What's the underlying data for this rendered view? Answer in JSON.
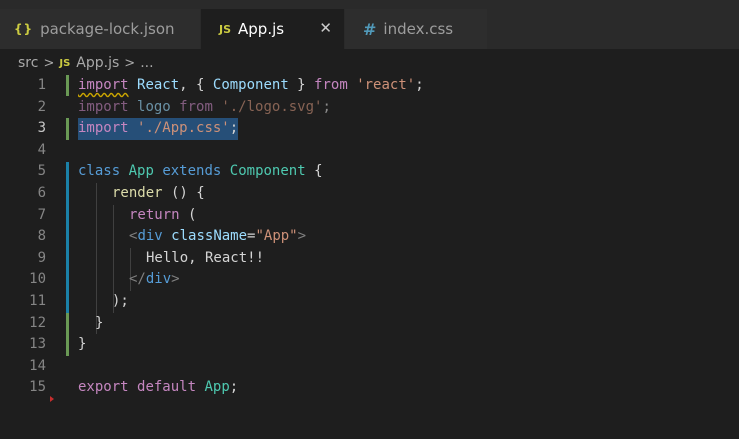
{
  "tabs": [
    {
      "icon": "{}",
      "icon_name": "json-file-icon",
      "label": "package-lock.json",
      "active": false
    },
    {
      "icon": "JS",
      "icon_name": "javascript-file-icon",
      "label": "App.js",
      "active": true,
      "close": "✕"
    },
    {
      "icon": "#",
      "icon_name": "css-file-icon",
      "label": "index.css",
      "active": false
    }
  ],
  "breadcrumb": {
    "folder": "src",
    "sep": ">",
    "file_icon": "JS",
    "file": "App.js",
    "ellipsis": "..."
  },
  "line_numbers": [
    "1",
    "2",
    "3",
    "4",
    "5",
    "6",
    "7",
    "8",
    "9",
    "10",
    "11",
    "12",
    "13",
    "14",
    "15"
  ],
  "active_line": "3",
  "code": {
    "l1": {
      "import": "import",
      "react": "React",
      "comma_open": ", { ",
      "component": "Component",
      "close": " } ",
      "from": "from",
      "str": "'react'",
      "semi": ";"
    },
    "l2": {
      "import": "import",
      "logo": "logo",
      "from": "from",
      "str": "'./logo.svg'",
      "semi": ";"
    },
    "l3": {
      "import": "import",
      "str": "'./App.css'",
      "semi": ";"
    },
    "l5": {
      "class": "class",
      "name": "App",
      "extends": "extends",
      "base": "Component",
      "brace": " {"
    },
    "l6": {
      "render": "render",
      "rest": " () {"
    },
    "l7": {
      "return": "return",
      "paren": " ("
    },
    "l8": {
      "open": "<",
      "tag": "div",
      "attr": "className",
      "eq": "=",
      "val": "\"App\"",
      "close": ">"
    },
    "l9": {
      "text": "Hello, React!!"
    },
    "l10": {
      "open": "</",
      "tag": "div",
      "close": ">"
    },
    "l11": {
      "text": ");"
    },
    "l12": {
      "text": "}"
    },
    "l13": {
      "text": "}"
    },
    "l15": {
      "export": "export",
      "default": "default",
      "name": "App",
      "semi": ";"
    }
  },
  "colors": {
    "background": "#1e1e1e",
    "selection": "#264f78",
    "modified_bar": "#6a9955",
    "changed_bar": "#1b81a8",
    "keyword": "#c586c0",
    "string": "#ce9178",
    "class": "#4ec9b0"
  }
}
